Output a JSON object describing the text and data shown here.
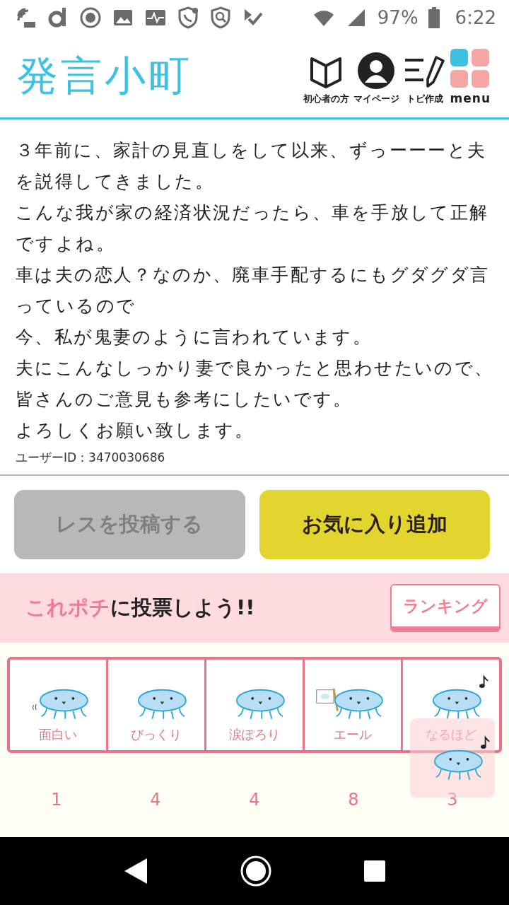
{
  "status_bar": {
    "battery": "97%",
    "time": "6:22"
  },
  "header": {
    "logo": "発言小町",
    "nav": [
      {
        "label": "初心者の方",
        "kind": "book"
      },
      {
        "label": "マイページ",
        "kind": "person"
      },
      {
        "label": "トピ作成",
        "kind": "pencil"
      },
      {
        "label": "menu",
        "kind": "grid"
      }
    ]
  },
  "post": {
    "paragraphs": [
      "３年前に、家計の見直しをして以来、ずっーーーと夫を説得してきました。",
      "こんな我が家の経済状況だったら、車を手放して正解ですよね。",
      "車は夫の恋人？なのか、廃車手配するにもグダグダ言っているので",
      "今、私が鬼妻のように言われています。",
      "夫にこんなしっかり妻で良かったと思わせたいので、",
      "皆さんのご意見も参考にしたいです。",
      "よろしくお願い致します。"
    ],
    "user_id": "ユーザーID：3470030686"
  },
  "actions": [
    {
      "label": "レスを投稿する",
      "disabled": true
    },
    {
      "label": "お気に入り追加",
      "disabled": false
    }
  ],
  "vote": {
    "title_highlight": "これポチ",
    "title_rest": "に投票しよう!!",
    "ranking_button": "ランキング",
    "reactions": [
      {
        "label": "面白い",
        "count": "1",
        "kind": "blush"
      },
      {
        "label": "びっくり",
        "count": "4",
        "kind": "sweat"
      },
      {
        "label": "涙ぽろり",
        "count": "4",
        "kind": "tears"
      },
      {
        "label": "エール",
        "count": "8",
        "kind": "flag"
      },
      {
        "label": "なるほど",
        "count": "3",
        "kind": "note"
      }
    ]
  }
}
